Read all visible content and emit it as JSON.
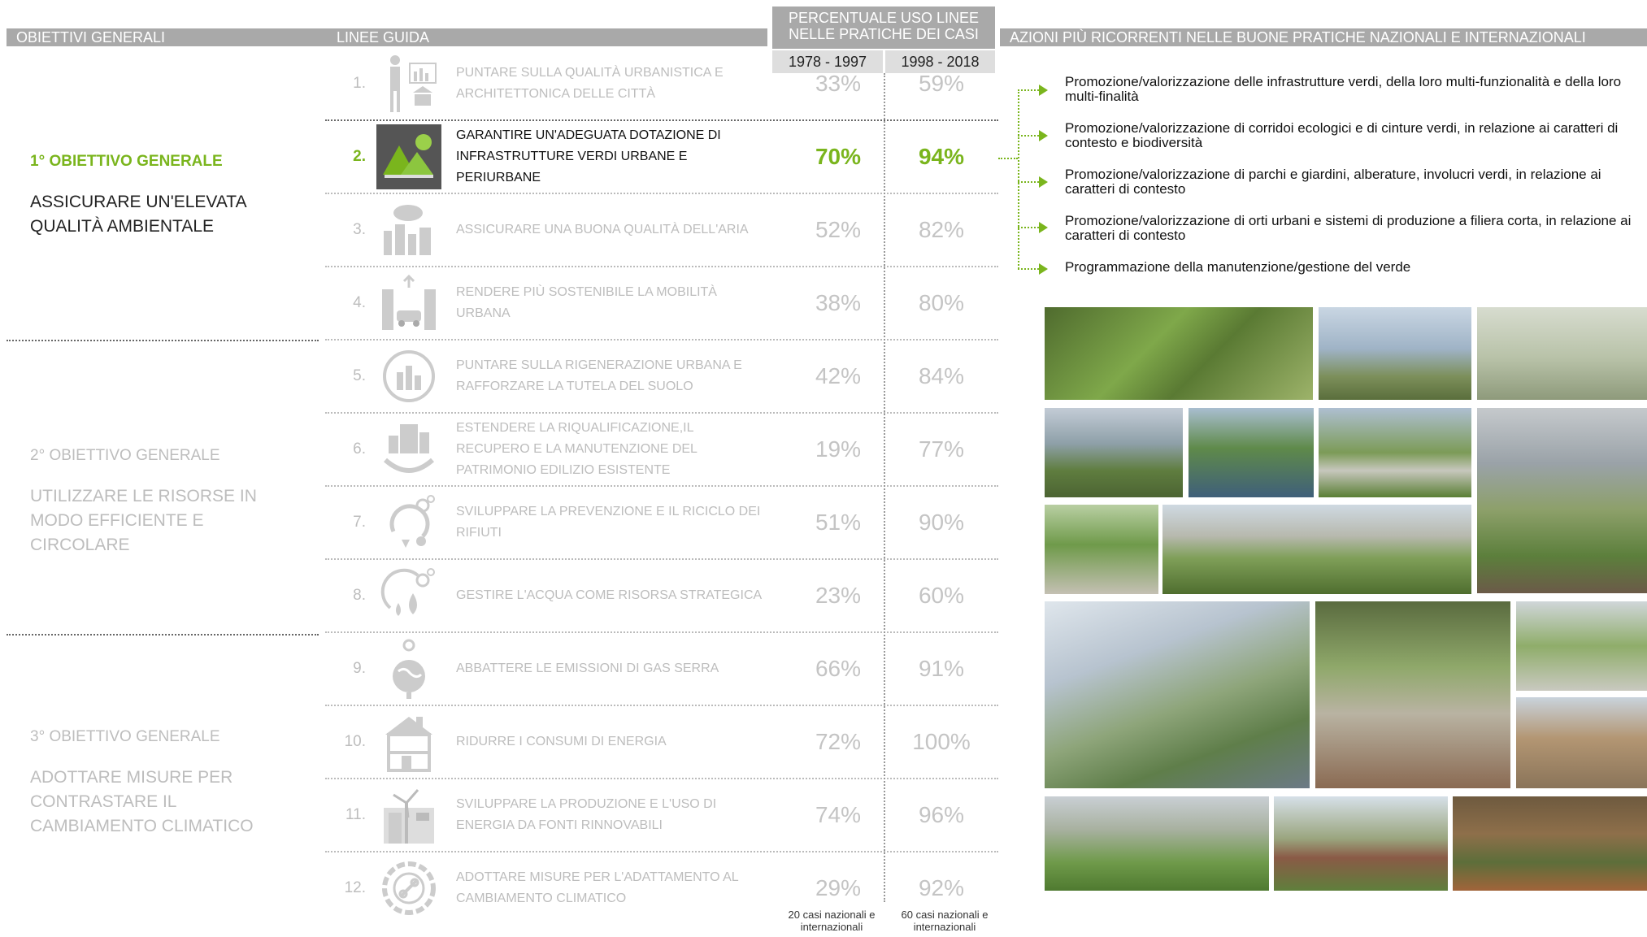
{
  "headers": {
    "objectives": "OBIETTIVI GENERALI",
    "guidelines": "LINEE GUIDA",
    "percentage": "PERCENTUALE USO LINEE NELLE PRATICHE DEI CASI",
    "period1": "1978 - 1997",
    "period2": "1998 - 2018",
    "actions": "AZIONI PIÙ RICORRENTI NELLE BUONE PRATICHE NAZIONALI E INTERNAZIONALI"
  },
  "objectives": [
    {
      "label": "1° OBIETTIVO GENERALE",
      "title": "ASSICURARE UN'ELEVATA QUALITÀ AMBIENTALE"
    },
    {
      "label": "2° OBIETTIVO GENERALE",
      "title": "UTILIZZARE LE RISORSE IN MODO EFFICIENTE E CIRCOLARE"
    },
    {
      "label": "3° OBIETTIVO GENERALE",
      "title": "ADOTTARE MISURE PER CONTRASTARE IL CAMBIAMENTO CLIMATICO"
    }
  ],
  "guidelines": [
    {
      "num": "1.",
      "text": "PUNTARE SULLA QUALITÀ URBANISTICA E ARCHITETTONICA DELLE CITTÀ",
      "p1": "33%",
      "p2": "59%",
      "icon": "city-architecture-icon"
    },
    {
      "num": "2.",
      "text": "GARANTIRE UN'ADEGUATA DOTAZIONE DI INFRASTRUTTURE VERDI URBANE E PERIURBANE",
      "p1": "70%",
      "p2": "94%",
      "icon": "green-infrastructure-icon"
    },
    {
      "num": "3.",
      "text": "ASSICURARE UNA BUONA QUALITÀ DELL'ARIA",
      "p1": "52%",
      "p2": "82%",
      "icon": "air-quality-icon"
    },
    {
      "num": "4.",
      "text": "RENDERE PIÙ SOSTENIBILE LA MOBILITÀ URBANA",
      "p1": "38%",
      "p2": "80%",
      "icon": "mobility-icon"
    },
    {
      "num": "5.",
      "text": "PUNTARE SULLA RIGENERAZIONE URBANA E RAFFORZARE LA TUTELA DEL SUOLO",
      "p1": "42%",
      "p2": "84%",
      "icon": "regeneration-icon"
    },
    {
      "num": "6.",
      "text": "ESTENDERE LA RIQUALIFICAZIONE,IL RECUPERO E LA MANUTENZIONE DEL PATRIMONIO EDILIZIO ESISTENTE",
      "p1": "19%",
      "p2": "77%",
      "icon": "building-heritage-icon"
    },
    {
      "num": "7.",
      "text": "SVILUPPARE LA PREVENZIONE E IL RICICLO DEI RIFIUTI",
      "p1": "51%",
      "p2": "90%",
      "icon": "recycle-icon"
    },
    {
      "num": "8.",
      "text": "GESTIRE L'ACQUA COME RISORSA STRATEGICA",
      "p1": "23%",
      "p2": "60%",
      "icon": "water-icon"
    },
    {
      "num": "9.",
      "text": "ABBATTERE LE EMISSIONI DI GAS SERRA",
      "p1": "66%",
      "p2": "91%",
      "icon": "emissions-globe-icon"
    },
    {
      "num": "10.",
      "text": "RIDURRE I CONSUMI DI ENERGIA",
      "p1": "72%",
      "p2": "100%",
      "icon": "energy-building-icon"
    },
    {
      "num": "11.",
      "text": "SVILUPPARE LA PRODUZIONE E L'USO DI ENERGIA DA FONTI RINNOVABILI",
      "p1": "74%",
      "p2": "96%",
      "icon": "renewable-energy-icon"
    },
    {
      "num": "12.",
      "text": "ADOTTARE MISURE PER L'ADATTAMENTO AL CAMBIAMENTO CLIMATICO",
      "p1": "29%",
      "p2": "92%",
      "icon": "climate-adaptation-icon"
    }
  ],
  "footnotes": {
    "left": "20 casi nazionali e internazionali",
    "right": "60 casi nazionali e internazionali"
  },
  "actions": [
    "Promozione/valorizzazione delle infrastrutture verdi, della loro multi-funzionalità e della loro multi-finalità",
    "Promozione/valorizzazione di corridoi ecologici e di cinture verdi, in relazione ai caratteri di contesto e biodiversità",
    "Promozione/valorizzazione di parchi e giardini, alberature, involucri verdi, in relazione ai caratteri di contesto",
    "Promozione/valorizzazione di orti urbani e sistemi di produzione a filiera corta, in relazione ai caratteri di contesto",
    "Programmazione della manutenzione/gestione del verde"
  ],
  "colors": {
    "accent": "#7ab51d",
    "header_bg": "#a9a9a9",
    "inactive_text": "#bdbdbd"
  }
}
